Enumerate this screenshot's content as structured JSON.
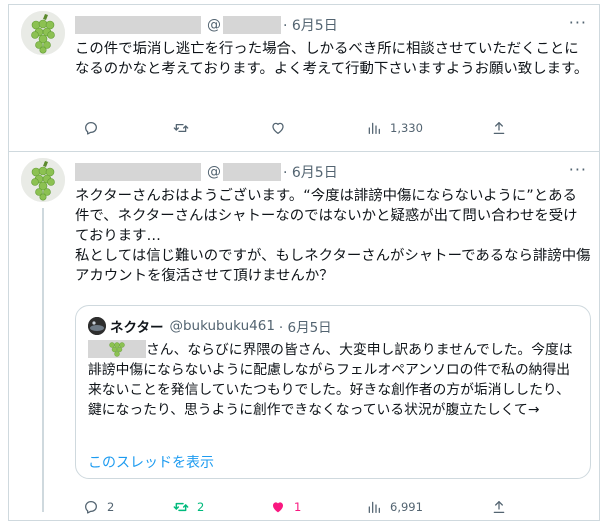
{
  "tweets": [
    {
      "handle_prefix": "@",
      "date": "· 6月5日",
      "more": "···",
      "text": "この件で垢消し逃亡を行った場合、しかるべき所に相談させていただくことになるのかなと考えております。よく考えて行動下さいますようお願い致します。",
      "actions": {
        "reply": "",
        "retweet": "",
        "like": "",
        "views": "1,330"
      }
    },
    {
      "handle_prefix": "@",
      "date": "· 6月5日",
      "more": "···",
      "paragraphs": [
        "ネクターさんおはようございます。“今度は誹謗中傷にならないように”とある件で、ネクターさんはシャトーなのではないかと疑惑が出て問い合わせを受けております…",
        "私としては信じ難いのですが、もしネクターさんがシャトーであるなら誹謗中傷アカウントを復活させて頂けませんか？"
      ],
      "quote": {
        "name": "ネクター",
        "handle": "@bukubuku461",
        "date": "· 6月5日",
        "text": "さん、ならびに界隈の皆さん、大変申し訳ありませんでした。今度は誹謗中傷にならないように配慮しながらフェルオペアンソロの件で私の納得出来ないことを発信していたつもりでした。好きな創作者の方が垢消ししたり、鍵になったり、思うように創作できなくなっている状況が腹立たしくて→",
        "show_thread": "このスレッドを表示"
      },
      "actions": {
        "reply": "2",
        "retweet": "2",
        "like": "1",
        "views": "6,991"
      }
    }
  ],
  "colors": {
    "accent": "#1d9bf0",
    "retweet": "#00ba7c",
    "like": "#f91880",
    "muted": "#536471",
    "border": "#cfd9de"
  }
}
